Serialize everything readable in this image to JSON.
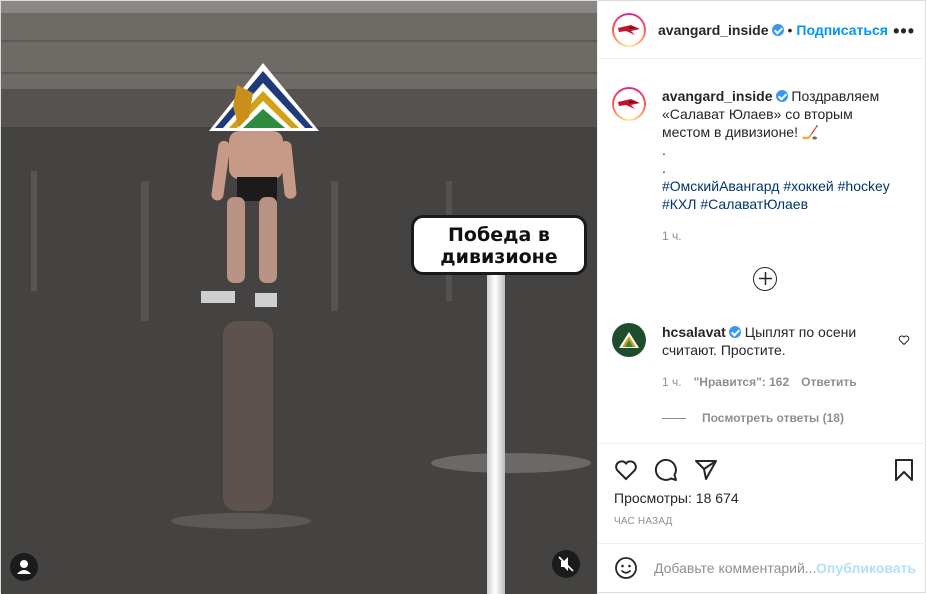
{
  "media": {
    "sign_line1": "Победа в",
    "sign_line2": "дивизионе"
  },
  "header": {
    "username": "avangard_inside",
    "dot": "•",
    "follow_label": "Подписаться",
    "more_label": "•••"
  },
  "caption": {
    "username": "avangard_inside",
    "text": "Поздравляем «Салават Юлаев» со вторым местом в дивизионе! 🏒",
    "dots": [
      ".",
      "."
    ],
    "hashtags": [
      "#ОмскийАвангард",
      "#хоккей",
      "#hockey",
      "#КХЛ",
      "#СалаватЮлаев"
    ],
    "time": "1 ч."
  },
  "comment": {
    "username": "hcsalavat",
    "text": "Цыплят по осени считают. Простите.",
    "time": "1 ч.",
    "likes": "\"Нравится\": 162",
    "reply_label": "Ответить",
    "view_replies": "Посмотреть ответы (18)"
  },
  "actions": {
    "views": "Просмотры: 18 674",
    "time_ago": "ЧАС НАЗАД"
  },
  "add_comment": {
    "placeholder": "Добавьте комментарий...",
    "publish_label": "Опубликовать"
  },
  "colors": {
    "accent": "#0095f6",
    "tag": "#00376b",
    "muted": "#8e8e8e",
    "publish_disabled": "#b2dffc"
  }
}
